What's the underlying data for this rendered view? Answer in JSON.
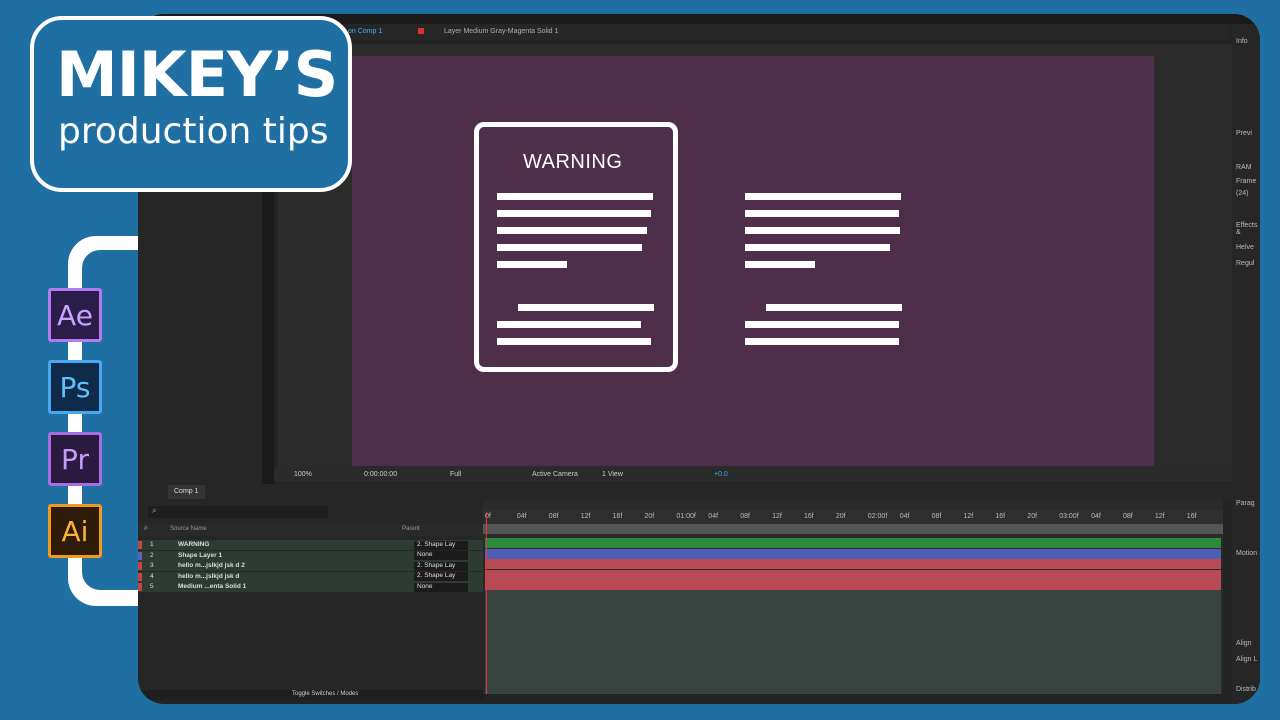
{
  "brand": {
    "title": "MIKEY’S",
    "subtitle": "production tips"
  },
  "app_icons": [
    {
      "label": "Ae",
      "icon": "after-effects-icon"
    },
    {
      "label": "Ps",
      "icon": "photoshop-icon"
    },
    {
      "label": "Pr",
      "icon": "premiere-icon"
    },
    {
      "label": "Ai",
      "icon": "illustrator-icon"
    }
  ],
  "viewer": {
    "tabs": {
      "comp": "on Comp 1",
      "layer": "Layer Medium Gray-Magenta Solid 1"
    },
    "doc_title": "WARNING",
    "toolbar": {
      "zoom": "100%",
      "timecode": "0:00:00:00",
      "resolution": "Full",
      "camera": "Active Camera",
      "view": "1 View",
      "exposure": "+0.0"
    }
  },
  "right_panel": {
    "info": "Info",
    "preview": "Previ",
    "ram": "RAM",
    "frame": "Frame",
    "fps": "(24)",
    "effects": "Effects &",
    "font": "Helve",
    "style": "Regul",
    "paragraph": "Parag",
    "motion": "Motion",
    "align": "Align",
    "align_l": "Align L",
    "distrib": "Distrib"
  },
  "timeline": {
    "tab": "Comp 1",
    "search_placeholder": "⌕",
    "headers": {
      "num": "#",
      "source": "Source Name",
      "parent": "Parent"
    },
    "layers": [
      {
        "num": "1",
        "name": "WARNING",
        "parent": "2. Shape Lay",
        "color": "#c94343",
        "track": "#2d8a3c"
      },
      {
        "num": "2",
        "name": "Shape Layer 1",
        "parent": "None",
        "color": "#5a63c4",
        "track": "#4f5db4"
      },
      {
        "num": "3",
        "name": "hello m...jslkjd jsk d 2",
        "parent": "2. Shape Lay",
        "color": "#c94343",
        "track": "#b84a55"
      },
      {
        "num": "4",
        "name": "hello m...jslkjd jsk d",
        "parent": "2. Shape Lay",
        "color": "#c94343",
        "track": "#b84a55"
      },
      {
        "num": "5",
        "name": "Medium ...enta Solid 1",
        "parent": "None",
        "color": "#c94343",
        "track": "#b84a55"
      }
    ],
    "ruler": [
      "0f",
      "04f",
      "08f",
      "12f",
      "16f",
      "20f",
      "01:00f",
      "04f",
      "08f",
      "12f",
      "16f",
      "20f",
      "02:00f",
      "04f",
      "08f",
      "12f",
      "16f",
      "20f",
      "03:00f",
      "04f",
      "08f",
      "12f",
      "16f"
    ],
    "toggle_label": "Toggle Switches / Modes"
  }
}
